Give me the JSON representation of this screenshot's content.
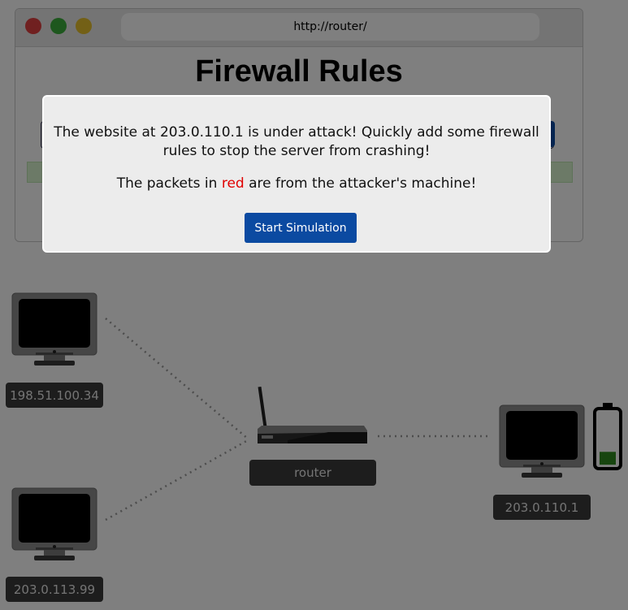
{
  "browser": {
    "url": "http://router/"
  },
  "page": {
    "title": "Firewall Rules"
  },
  "modal": {
    "line1": "The website at 203.0.110.1 is under attack! Quickly add some firewall rules to stop the server from crashing!",
    "line2_before": "The packets in ",
    "line2_red": "red",
    "line2_after": " are from the attacker's machine!",
    "button_label": "Start Simulation"
  },
  "network": {
    "host_top_left": "198.51.100.34",
    "host_bottom_left": "203.0.113.99",
    "router": "router",
    "server": "203.0.110.1",
    "server_battery_level": 0.25
  },
  "colors": {
    "accent": "#0b4aa1",
    "attacker_packet": "#e00000",
    "battery_fill": "#2e8b1e"
  }
}
